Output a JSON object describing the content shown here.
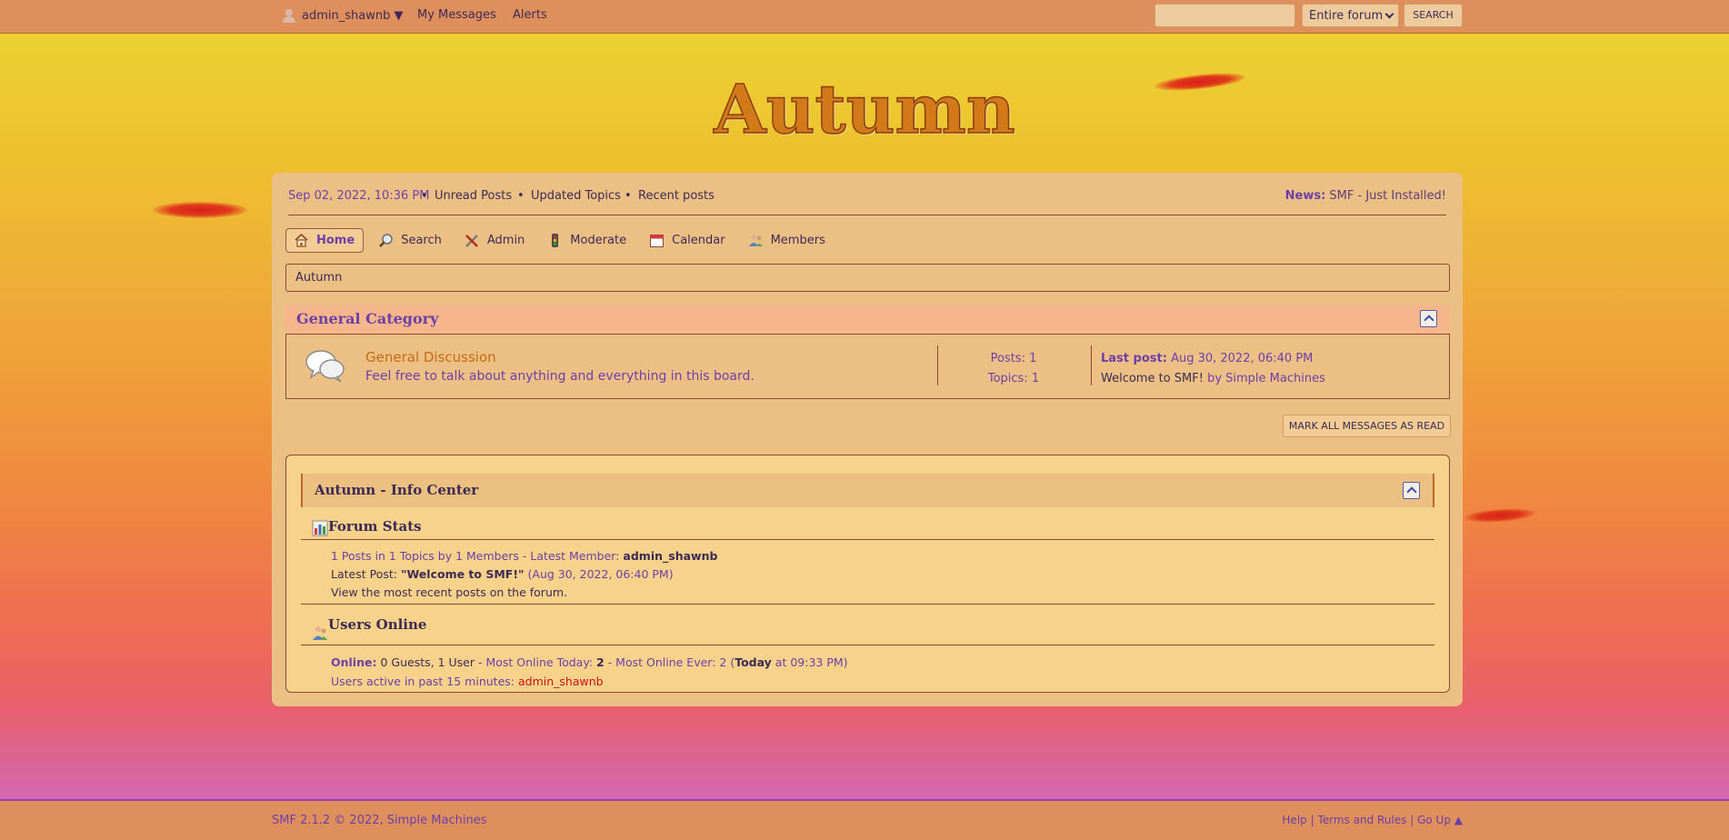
{
  "topbar": {
    "username": "admin_shawnb ▼",
    "my_messages": "My Messages",
    "alerts": "Alerts",
    "search_placeholder": "",
    "search_scope": "Entire forum",
    "search_button": "SEARCH"
  },
  "logo": "Autumn",
  "upper": {
    "date": "Sep 02, 2022, 10:36 PM",
    "unread": "Unread Posts",
    "updated": "Updated Topics",
    "recent": "Recent posts",
    "news_label": "News:",
    "news_text": "SMF - Just Installed!"
  },
  "menu": [
    {
      "label": "Home",
      "icon": "home-icon"
    },
    {
      "label": "Search",
      "icon": "search-icon"
    },
    {
      "label": "Admin",
      "icon": "admin-icon"
    },
    {
      "label": "Moderate",
      "icon": "moderate-icon"
    },
    {
      "label": "Calendar",
      "icon": "calendar-icon"
    },
    {
      "label": "Members",
      "icon": "members-icon"
    }
  ],
  "breadcrumb": "Autumn",
  "category": {
    "title": "General Category",
    "board": {
      "name": "General Discussion",
      "description": "Feel free to talk about anything and everything in this board.",
      "posts": "Posts: 1",
      "topics": "Topics: 1",
      "lastpost_label": "Last post:",
      "lastpost_date": "Aug 30, 2022, 06:40 PM",
      "lastpost_topic": "Welcome to SMF!",
      "lastpost_by": "by Simple Machines"
    }
  },
  "mark_read": "MARK ALL MESSAGES AS READ",
  "info": {
    "title": "Autumn - Info Center",
    "stats_title": "Forum Stats",
    "stats_line1_a": "1 Posts in 1 Topics by 1 Members - Latest Member:",
    "stats_line1_member": "admin_shawnb",
    "stats_line2_label": "Latest Post:",
    "stats_line2_topic": "\"Welcome to SMF!\"",
    "stats_line2_date": "(Aug 30, 2022, 06:40 PM)",
    "stats_line3": "View the most recent posts on the forum.",
    "online_title": "Users Online",
    "online_label": "Online:",
    "online_counts": "0 Guests, 1 User",
    "online_today": "- Most Online Today:",
    "online_today_val": "2",
    "online_ever": "- Most Online Ever: 2 (",
    "online_ever_today": "Today",
    "online_ever_time": "at 09:33 PM)",
    "active_label": "Users active in past 15 minutes:",
    "active_user": "admin_shawnb"
  },
  "footer": {
    "left": "SMF 2.1.2 © 2022,",
    "left_link": "Simple Machines",
    "help": "Help",
    "terms": "Terms and Rules",
    "goup": "Go Up ▲",
    "sep": "|"
  }
}
